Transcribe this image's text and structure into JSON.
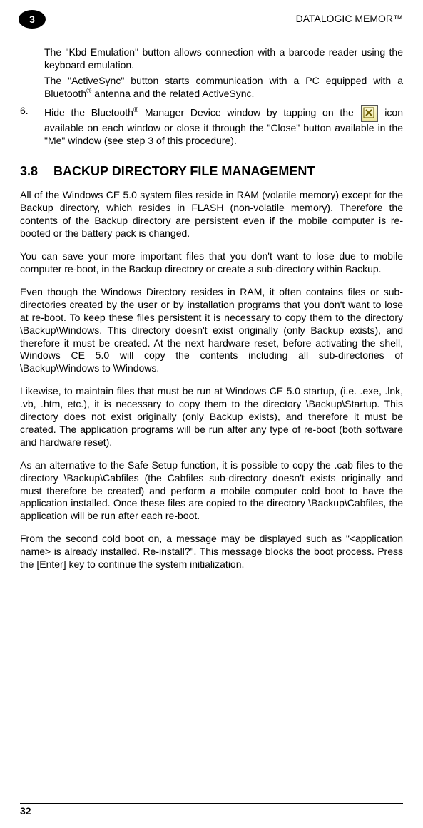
{
  "header": {
    "product": "DATALOGIC MEMOR™",
    "chapter_badge": "3"
  },
  "intro": {
    "p1": "The \"Kbd Emulation\" button allows connection with a barcode reader using the keyboard emulation.",
    "p2a": "The \"ActiveSync\" button starts communication with a PC equipped with a Bluetooth",
    "p2b": " antenna and the related ActiveSync."
  },
  "step6": {
    "num": "6.",
    "a": "Hide the Bluetooth",
    "b": " Manager Device window by tapping on the ",
    "c": " icon available on each window or close it through the \"Close\" button available in the \"Me\" window (see step 3 of this procedure)."
  },
  "section": {
    "num": "3.8",
    "title": "BACKUP DIRECTORY FILE MANAGEMENT"
  },
  "paras": {
    "p1": "All of the Windows CE 5.0 system files reside in RAM (volatile memory) except for the Backup directory, which resides in FLASH (non-volatile memory). Therefore the contents of the Backup directory are persistent even if the mobile computer is re-booted or the battery pack is changed.",
    "p2": "You can save your more important files that you don't want to lose due to mobile computer re-boot, in the Backup directory or create a sub-directory within Backup.",
    "p3": "Even though the Windows Directory resides in RAM, it often contains files or sub-directories created by the user or by installation programs that you don't want to lose at re-boot. To keep these files persistent it is necessary to copy them to the directory \\Backup\\Windows. This directory doesn't exist originally (only Backup exists), and therefore it must be created. At the next hardware reset, before activating the shell, Windows CE 5.0 will copy the contents including all sub-directories of \\Backup\\Windows to \\Windows.",
    "p4": "Likewise, to maintain files that must be run at Windows CE 5.0 startup, (i.e. .exe, .lnk, .vb, .htm, etc.), it is necessary to copy them to the directory \\Backup\\Startup. This directory does not exist originally (only Backup exists), and therefore it must be created. The application programs will be run after any type of re-boot (both software and hardware reset).",
    "p5": "As an alternative to the Safe Setup function, it is possible to copy the .cab files to the directory \\Backup\\Cabfiles (the Cabfiles sub-directory doesn't exists originally and must therefore be created) and perform a mobile computer cold boot to have the application installed. Once these files are copied to the directory \\Backup\\Cabfiles, the application will be run after each re-boot.",
    "p6": "From the second cold boot on, a message may be displayed such as \"<application name> is already installed. Re-install?\". This message blocks the boot process. Press the [Enter] key to continue the system initialization."
  },
  "footer": {
    "page_num": "32"
  },
  "reg_mark": "®"
}
